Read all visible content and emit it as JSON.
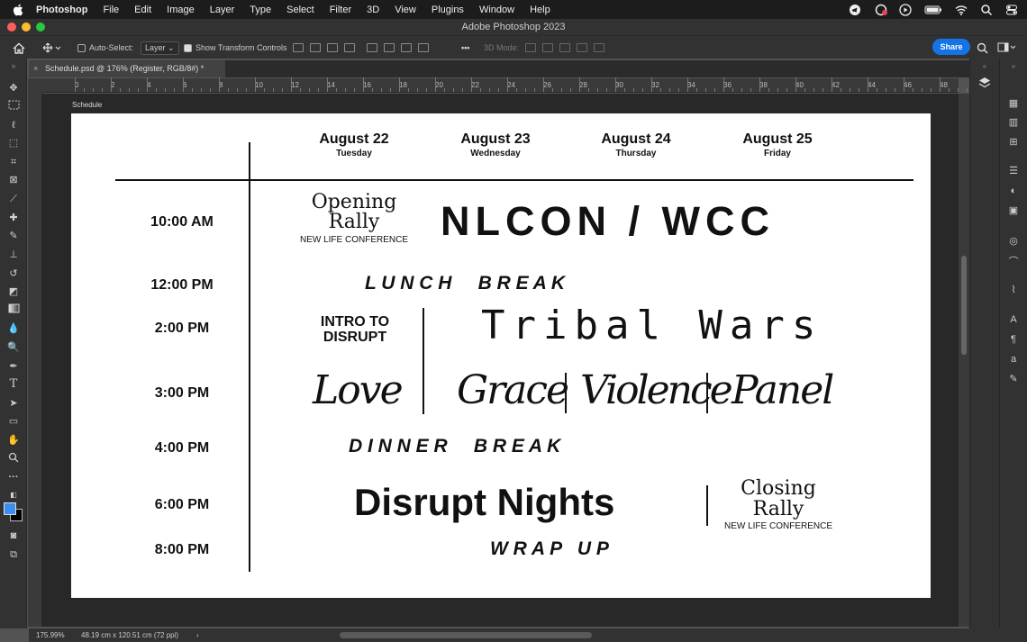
{
  "menubar": {
    "items": [
      "Photoshop",
      "File",
      "Edit",
      "Image",
      "Layer",
      "Type",
      "Select",
      "Filter",
      "3D",
      "View",
      "Plugins",
      "Window",
      "Help"
    ],
    "status_icons": [
      "telegram-icon",
      "creative-cloud-icon",
      "play-icon",
      "battery-icon",
      "wifi-icon",
      "spotlight-search-icon",
      "control-center-icon"
    ]
  },
  "window": {
    "title": "Adobe Photoshop 2023"
  },
  "options_bar": {
    "auto_select_label": "Auto-Select:",
    "auto_select_checked": false,
    "layer_dropdown": "Layer",
    "transform_label": "Show Transform Controls",
    "transform_checked": true,
    "mode_3d_label": "3D Mode:",
    "share_label": "Share"
  },
  "document_tab": {
    "close": "×",
    "title": "Schedule.psd @ 176% (Register, RGB/8#) *"
  },
  "ruler": {
    "h_labels": [
      "0",
      "2",
      "4",
      "6",
      "8",
      "10",
      "12",
      "14",
      "16",
      "18",
      "20",
      "22",
      "24",
      "26",
      "28",
      "30",
      "32",
      "34",
      "36",
      "38",
      "40",
      "42",
      "44",
      "46",
      "48"
    ]
  },
  "artboard": {
    "name": "Schedule"
  },
  "schedule": {
    "days": [
      {
        "date": "August 22",
        "weekday": "Tuesday"
      },
      {
        "date": "August 23",
        "weekday": "Wednesday"
      },
      {
        "date": "August 24",
        "weekday": "Thursday"
      },
      {
        "date": "August 25",
        "weekday": "Friday"
      }
    ],
    "times": [
      "10:00 AM",
      "12:00 PM",
      "2:00 PM",
      "3:00 PM",
      "4:00 PM",
      "6:00 PM",
      "8:00 PM"
    ],
    "opening_rally": {
      "line1": "Opening",
      "line2": "Rally",
      "sub": "NEW LIFE CONFERENCE"
    },
    "nlcon": "NLCON / WCC",
    "lunch": "L U N C H     B R E A K",
    "intro": {
      "line1": "INTRO TO",
      "line2": "DISRUPT"
    },
    "tribal": "Tribal Wars",
    "love": "Love",
    "grace": "Grace",
    "violence": "Violence",
    "panel": "Panel",
    "dinner": "D I N N E R     B R E A K",
    "disrupt_nights": "Disrupt Nights",
    "closing_rally": {
      "line1": "Closing",
      "line2": "Rally",
      "sub": "NEW LIFE CONFERENCE"
    },
    "wrap_up": "W R A P   U P"
  },
  "status_bar": {
    "zoom": "175.99%",
    "doc_size": "48.19 cm x 120.51 cm (72 ppi)",
    "arrow": "›"
  },
  "colors": {
    "foreground": "#3d8ef0",
    "background": "#000000",
    "share": "#1473e6"
  }
}
